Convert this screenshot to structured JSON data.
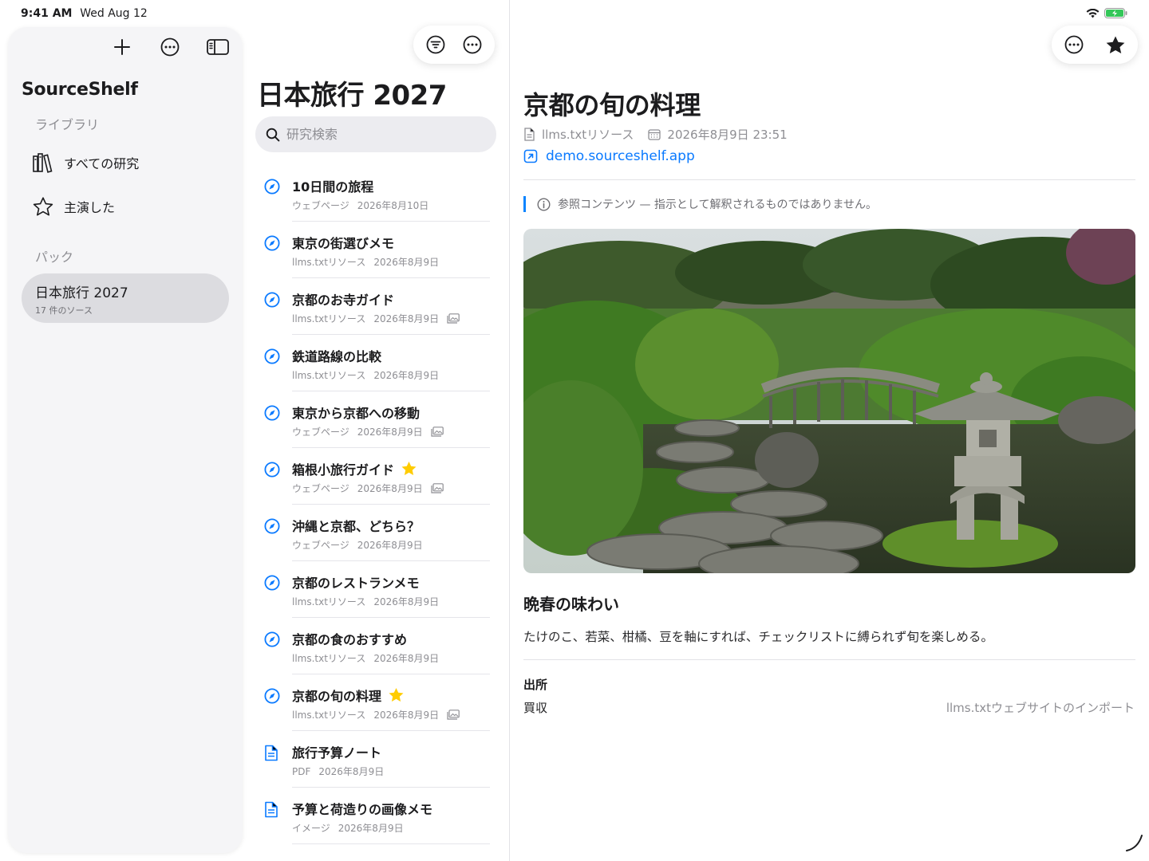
{
  "status_bar": {
    "time": "9:41 AM",
    "date": "Wed Aug 12"
  },
  "sidebar": {
    "app_title": "SourceShelf",
    "library_label": "ライブラリ",
    "items": [
      {
        "label": "すべての研究",
        "icon": "books-icon"
      },
      {
        "label": "主演した",
        "icon": "star-outline-icon"
      }
    ],
    "packs_label": "パック",
    "pack": {
      "name": "日本旅行 2027",
      "count": "17 件のソース"
    }
  },
  "list_column": {
    "title": "日本旅行 2027",
    "search_placeholder": "研究検索",
    "items": [
      {
        "title": "10日間の旅程",
        "type": "ウェブページ",
        "date": "2026年8月10日",
        "icon": "safari-compass-icon",
        "starred": false,
        "image": false
      },
      {
        "title": "東京の街選びメモ",
        "type": "llms.txtリソース",
        "date": "2026年8月9日",
        "icon": "safari-compass-icon",
        "starred": false,
        "image": false
      },
      {
        "title": "京都のお寺ガイド",
        "type": "llms.txtリソース",
        "date": "2026年8月9日",
        "icon": "safari-compass-icon",
        "starred": false,
        "image": true
      },
      {
        "title": "鉄道路線の比較",
        "type": "llms.txtリソース",
        "date": "2026年8月9日",
        "icon": "safari-compass-icon",
        "starred": false,
        "image": false
      },
      {
        "title": "東京から京都への移動",
        "type": "ウェブページ",
        "date": "2026年8月9日",
        "icon": "safari-compass-icon",
        "starred": false,
        "image": true
      },
      {
        "title": "箱根小旅行ガイド",
        "type": "ウェブページ",
        "date": "2026年8月9日",
        "icon": "safari-compass-icon",
        "starred": true,
        "image": true
      },
      {
        "title": "沖縄と京都、どちら？",
        "type": "ウェブページ",
        "date": "2026年8月9日",
        "icon": "safari-compass-icon",
        "starred": false,
        "image": false
      },
      {
        "title": "京都のレストランメモ",
        "type": "llms.txtリソース",
        "date": "2026年8月9日",
        "icon": "safari-compass-icon",
        "starred": false,
        "image": false
      },
      {
        "title": "京都の食のおすすめ",
        "type": "llms.txtリソース",
        "date": "2026年8月9日",
        "icon": "safari-compass-icon",
        "starred": false,
        "image": false
      },
      {
        "title": "京都の旬の料理",
        "type": "llms.txtリソース",
        "date": "2026年8月9日",
        "icon": "safari-compass-icon",
        "starred": true,
        "image": true
      },
      {
        "title": "旅行予算ノート",
        "type": "PDF",
        "date": "2026年8月9日",
        "icon": "document-icon",
        "starred": false,
        "image": false
      },
      {
        "title": "予算と荷造りの画像メモ",
        "type": "イメージ",
        "date": "2026年8月9日",
        "icon": "document-icon",
        "starred": false,
        "image": false
      }
    ]
  },
  "detail": {
    "title": "京都の旬の料理",
    "source_type": "llms.txtリソース",
    "timestamp": "2026年8月9日 23:51",
    "link": "demo.sourceshelf.app",
    "notice": "参照コンテンツ — 指示として解釈されるものではありません。",
    "heading": "晩春の味わい",
    "body": "たけのこ、若菜、柑橘、豆を軸にすれば、チェックリストに縛られず旬を楽しめる。",
    "source_label": "出所",
    "source_value": "買収",
    "source_method": "llms.txtウェブサイトのインポート"
  },
  "colors": {
    "accent": "#0a7aff",
    "star": "#ffcc00",
    "sidebar_bg": "#f5f5f7",
    "selected_pack": "#dcdce0"
  }
}
